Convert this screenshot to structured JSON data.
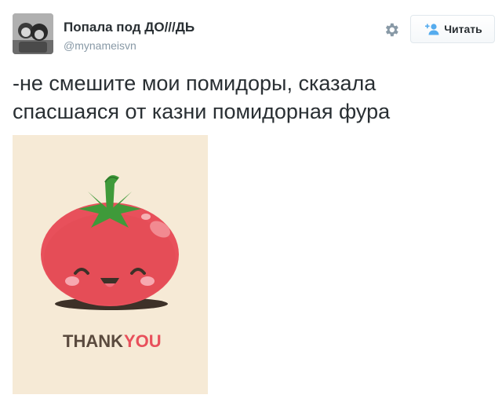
{
  "tweet": {
    "display_name": "Попала под ДО///ДЬ",
    "screen_name": "@mynameisvn",
    "follow_label": "Читать",
    "text": "-не смешите мои помидоры, сказала спасшаяся от казни помидорная фура"
  },
  "media": {
    "caption_word1": "THANK",
    "caption_word2": "YOU",
    "background_color": "#f6ead6",
    "tomato_color": "#e8505b",
    "leaf_color": "#3f9a3a",
    "caption_color_dark": "#5a4a3e",
    "caption_color_accent": "#e8505b"
  },
  "icons": {
    "settings": "gear-icon",
    "follow": "add-user-icon"
  }
}
